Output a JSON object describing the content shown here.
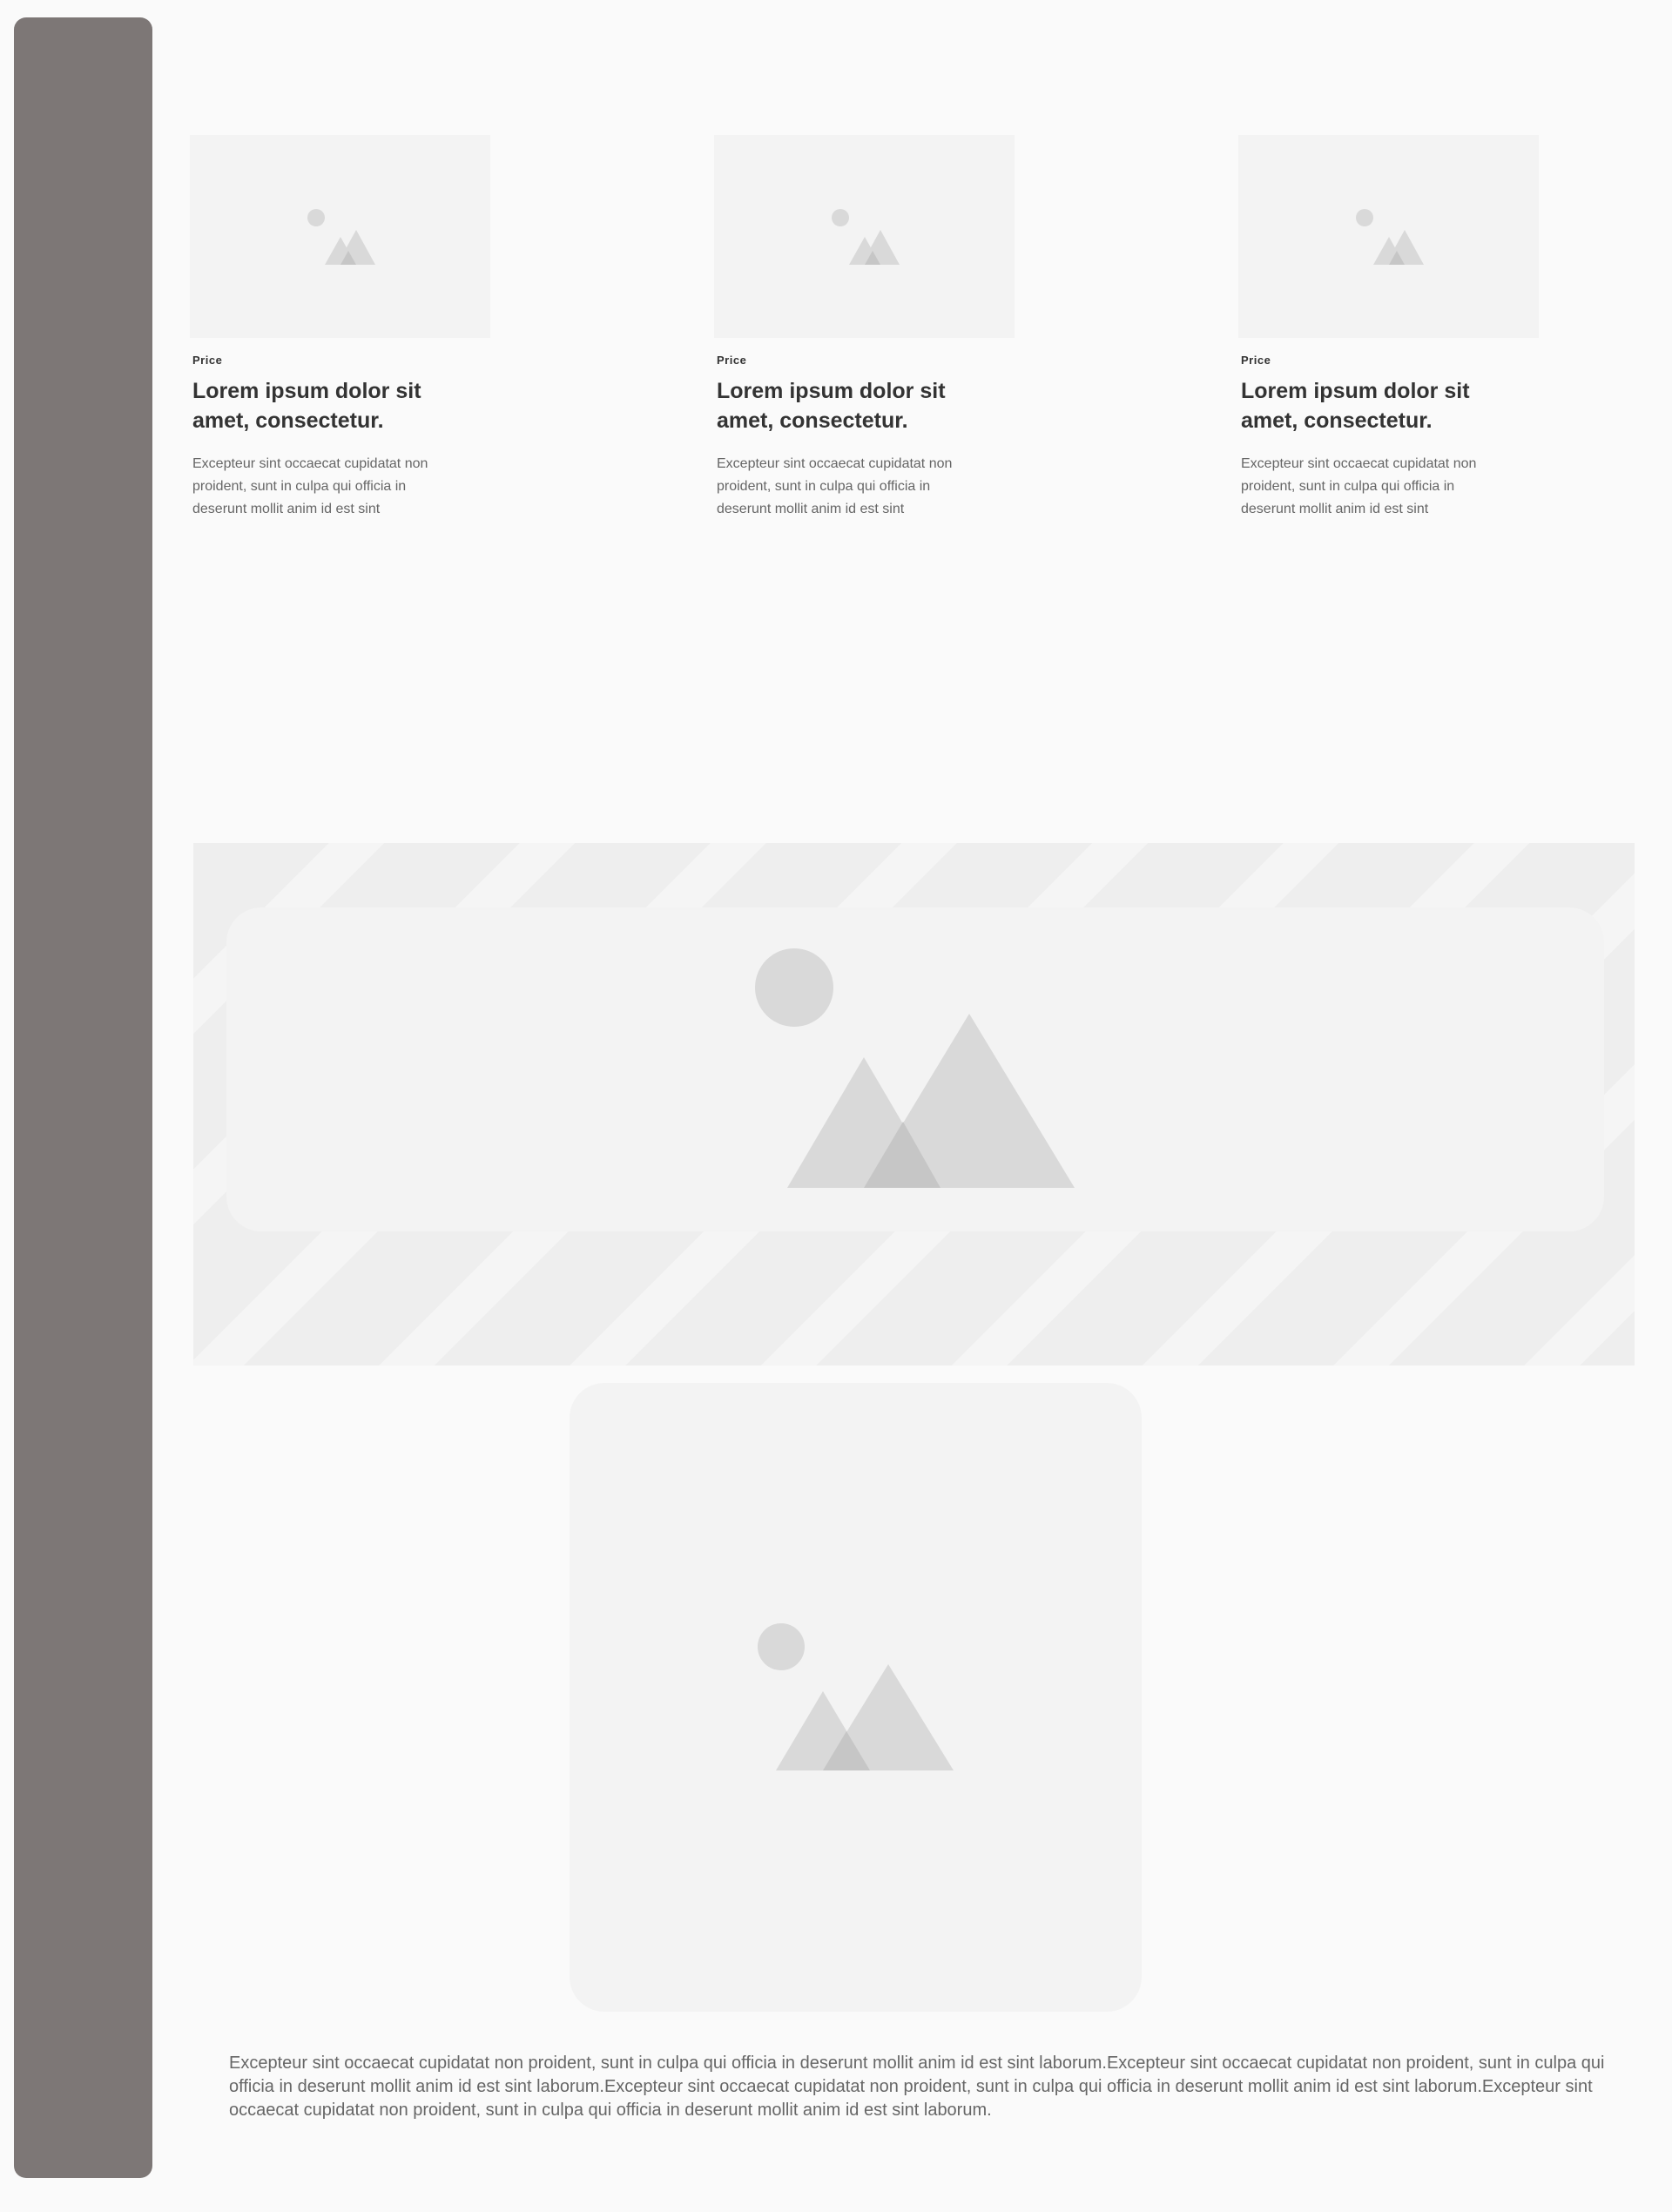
{
  "sidebar": {
    "color": "#7d7776"
  },
  "cards": [
    {
      "price_label": "Price",
      "title": "Lorem ipsum dolor sit amet, consectetur.",
      "description": "Excepteur sint occaecat cupidatat non proident, sunt in culpa qui officia in deserunt mollit anim id est sint",
      "image_icon": "image-placeholder-icon"
    },
    {
      "price_label": "Price",
      "title": "Lorem ipsum dolor sit amet, consectetur.",
      "description": "Excepteur sint occaecat cupidatat non proident, sunt in culpa qui officia in deserunt mollit anim id est sint",
      "image_icon": "image-placeholder-icon"
    },
    {
      "price_label": "Price",
      "title": "Lorem ipsum dolor sit amet, consectetur.",
      "description": "Excepteur sint occaecat cupidatat non proident, sunt in culpa qui officia in deserunt mollit anim id est sint",
      "image_icon": "image-placeholder-icon"
    }
  ],
  "hero": {
    "image_icon": "image-placeholder-icon"
  },
  "feature_image": {
    "image_icon": "image-placeholder-icon"
  },
  "body_text": "Excepteur sint occaecat cupidatat non proident, sunt in culpa qui officia in deserunt mollit anim id est sint laborum.Excepteur sint occaecat cupidatat non proident, sunt in culpa qui officia in deserunt mollit anim id est sint laborum.Excepteur sint occaecat cupidatat non proident, sunt in culpa qui officia in deserunt mollit anim id est sint laborum.Excepteur sint occaecat cupidatat non proident, sunt in culpa qui officia in deserunt mollit anim id est sint laborum.",
  "colors": {
    "background": "#fafafa",
    "placeholder": "#f3f3f3",
    "placeholder_shape": "#d9d9d9",
    "title_text": "#333333",
    "body_text": "#666666"
  }
}
